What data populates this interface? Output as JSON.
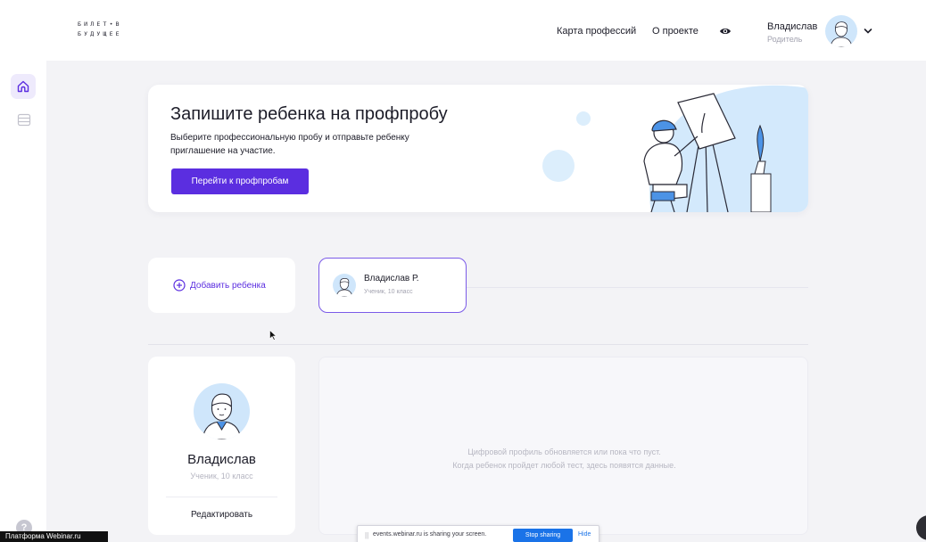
{
  "header": {
    "logo_line1": "БИЛЕТ•В",
    "logo_line2": "БУДУЩЕЕ",
    "nav": [
      "Карта профессий",
      "О проекте"
    ],
    "user_name": "Владислав",
    "user_role": "Родитель"
  },
  "banner": {
    "title": "Запишите ребенка на профпробу",
    "description": "Выберите профессиональную пробу и отправьте ребенку приглашение на участие.",
    "button": "Перейти к профпробам"
  },
  "children": {
    "add_label": "Добавить ребенка",
    "items": [
      {
        "name": "Владислав Р.",
        "meta": "Ученик, 10 класс"
      }
    ]
  },
  "profile": {
    "name": "Владислав",
    "meta": "Ученик, 10 класс",
    "edit": "Редактировать"
  },
  "digital_profile": {
    "line1": "Цифровой профиль обновляется или пока что пуст.",
    "line2": "Когда ребенок пройдет любой тест, здесь появятся данные."
  },
  "share_bar": {
    "text": "events.webinar.ru is sharing your screen.",
    "stop": "Stop sharing",
    "hide": "Hide"
  },
  "overlay_label": "Платформа Webinar.ru",
  "help_glyph": "?",
  "colors": {
    "accent": "#5b2ee0",
    "illustration_blue": "#cfe6fb",
    "share_blue": "#1a73e8"
  }
}
